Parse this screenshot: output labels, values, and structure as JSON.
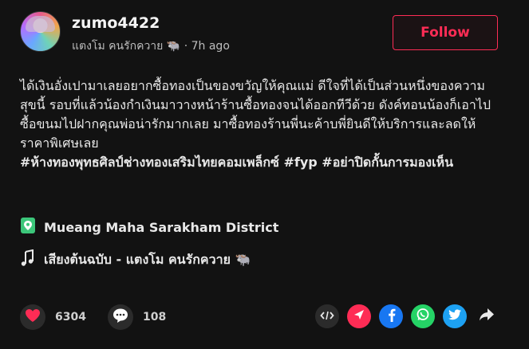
{
  "post": {
    "username": "zumo4422",
    "display_name": "แตงโม คนรักควาย",
    "separator": "·",
    "time_ago": "7h ago",
    "follow_label": "Follow",
    "caption_text": "ได้เงินอั่งเปามาเลยอยากซื้อทองเป็นของขวัญให้คุณแม่ ดีใจที่ได้เป็นส่วนหนึ่งของความสุขนี้ รอบที่แล้วน้องกำเงินมาวางหน้าร้านซื้อทองจนได้ออกทีวีด้วย ดังค์ทอนน้องก็เอาไปซื้อขนมไปฝากคุณพ่อน่ารักมากเลย มาซื้อทองร้านพี่นะค้าบพี่ยินดีให้บริการและลดให้ราคาพิเศษเลย",
    "hashtags": "#ห้างทองพุทธศิลป์ช่างทองเสริมไทยคอมเพล็กซ์ #fyp #อย่าปิดกั้นการมองเห็น",
    "location": "Mueang Maha Sarakham District",
    "music": "เสียงต้นฉบับ - แตงโม คนรักควาย",
    "likes": "6304",
    "comments": "108"
  },
  "icons": {
    "buffalo": "buffalo-emoji-icon",
    "location": "location-pin-icon",
    "music": "music-note-icon",
    "like": "heart-icon",
    "comment": "comment-bubble-icon",
    "embed": "embed-code-icon",
    "send": "send-arrow-icon",
    "facebook": "facebook-icon",
    "whatsapp": "whatsapp-icon",
    "twitter": "twitter-icon",
    "share": "share-arrow-icon"
  },
  "colors": {
    "accent": "#fe2c55",
    "location_green": "#3cc67a",
    "facebook": "#1877f2",
    "whatsapp": "#25d366",
    "twitter": "#1da1f2",
    "send": "#fe2c55"
  }
}
